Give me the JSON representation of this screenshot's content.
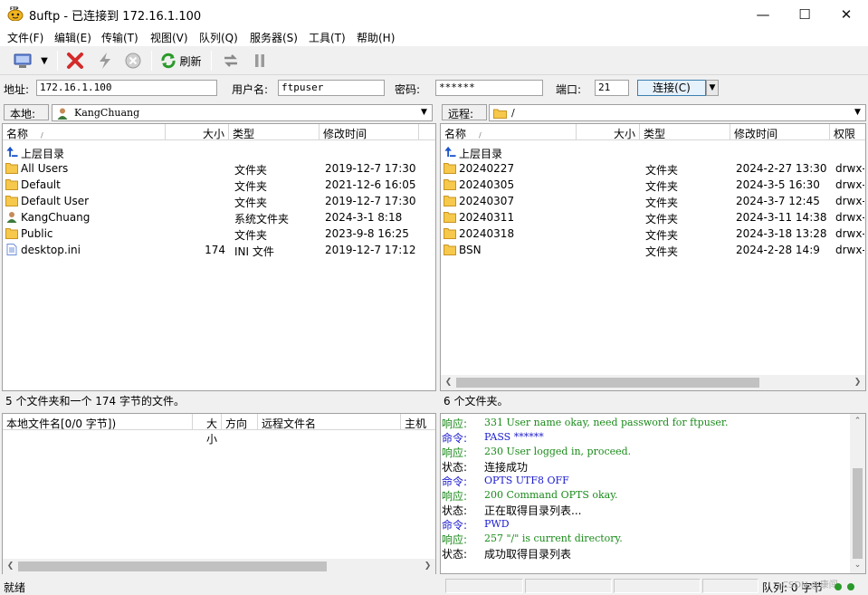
{
  "window": {
    "title": "8uftp - 已连接到 172.16.1.100"
  },
  "menu": [
    "文件(F)",
    "编辑(E)",
    "传输(T)",
    "视图(V)",
    "队列(Q)",
    "服务器(S)",
    "工具(T)",
    "帮助(H)"
  ],
  "toolbar": {
    "refresh_label": "刷新"
  },
  "address": {
    "host_label": "地址:",
    "host_value": "172.16.1.100",
    "user_label": "用户名:",
    "user_value": "ftpuser",
    "pass_label": "密码:",
    "pass_value": "******",
    "port_label": "端口:",
    "port_value": "21",
    "connect_label": "连接(C)"
  },
  "local": {
    "path_label": "本地:",
    "path_value": "KangChuang",
    "columns": [
      "名称",
      "大小",
      "类型",
      "修改时间"
    ],
    "parent_label": "上层目录",
    "files": [
      {
        "name": "All Users",
        "size": "",
        "type": "文件夹",
        "mtime": "2019-12-7 17:30",
        "icon": "folder-icon"
      },
      {
        "name": "Default",
        "size": "",
        "type": "文件夹",
        "mtime": "2021-12-6 16:05",
        "icon": "folder-icon"
      },
      {
        "name": "Default User",
        "size": "",
        "type": "文件夹",
        "mtime": "2019-12-7 17:30",
        "icon": "folder-icon"
      },
      {
        "name": "KangChuang",
        "size": "",
        "type": "系统文件夹",
        "mtime": "2024-3-1 8:18",
        "icon": "user-folder-icon"
      },
      {
        "name": "Public",
        "size": "",
        "type": "文件夹",
        "mtime": "2023-9-8 16:25",
        "icon": "folder-icon"
      },
      {
        "name": "desktop.ini",
        "size": "174",
        "type": "INI 文件",
        "mtime": "2019-12-7 17:12",
        "icon": "ini-file-icon"
      }
    ],
    "status": "5 个文件夹和一个 174 字节的文件。"
  },
  "remote": {
    "path_label": "远程:",
    "path_value": "/",
    "columns": [
      "名称",
      "大小",
      "类型",
      "修改时间",
      "权限"
    ],
    "parent_label": "上层目录",
    "files": [
      {
        "name": "20240227",
        "size": "",
        "type": "文件夹",
        "mtime": "2024-2-27 13:30",
        "perm": "drwx-"
      },
      {
        "name": "20240305",
        "size": "",
        "type": "文件夹",
        "mtime": "2024-3-5 16:30",
        "perm": "drwx-"
      },
      {
        "name": "20240307",
        "size": "",
        "type": "文件夹",
        "mtime": "2024-3-7 12:45",
        "perm": "drwx-"
      },
      {
        "name": "20240311",
        "size": "",
        "type": "文件夹",
        "mtime": "2024-3-11 14:38",
        "perm": "drwx-"
      },
      {
        "name": "20240318",
        "size": "",
        "type": "文件夹",
        "mtime": "2024-3-18 13:28",
        "perm": "drwx-"
      },
      {
        "name": "BSN",
        "size": "",
        "type": "文件夹",
        "mtime": "2024-2-28 14:9",
        "perm": "drwx-"
      }
    ],
    "status": "6 个文件夹。"
  },
  "queue": {
    "columns": [
      "本地文件名[0/0 字节])",
      "大小",
      "方向",
      "远程文件名",
      "主机"
    ]
  },
  "log": [
    {
      "tag": "响应:",
      "msg": "331 User name okay, need password for ftpuser.",
      "color": "#1a8a1a"
    },
    {
      "tag": "命令:",
      "msg": "PASS ******",
      "color": "#1a1ad0"
    },
    {
      "tag": "响应:",
      "msg": "230 User logged in, proceed.",
      "color": "#1a8a1a"
    },
    {
      "tag": "状态:",
      "msg": "连接成功",
      "color": "#000000"
    },
    {
      "tag": "命令:",
      "msg": "OPTS UTF8 OFF",
      "color": "#1a1ad0"
    },
    {
      "tag": "响应:",
      "msg": "200 Command OPTS okay.",
      "color": "#1a8a1a"
    },
    {
      "tag": "状态:",
      "msg": "正在取得目录列表...",
      "color": "#000000"
    },
    {
      "tag": "命令:",
      "msg": "PWD",
      "color": "#1a1ad0"
    },
    {
      "tag": "响应:",
      "msg": "257 \"/\" is current directory.",
      "color": "#1a8a1a"
    },
    {
      "tag": "状态:",
      "msg": "成功取得目录列表",
      "color": "#000000"
    }
  ],
  "statusbar": {
    "left": "就绪",
    "queue": "队列: 0 字节",
    "watermark": "CSDN @康闯"
  }
}
